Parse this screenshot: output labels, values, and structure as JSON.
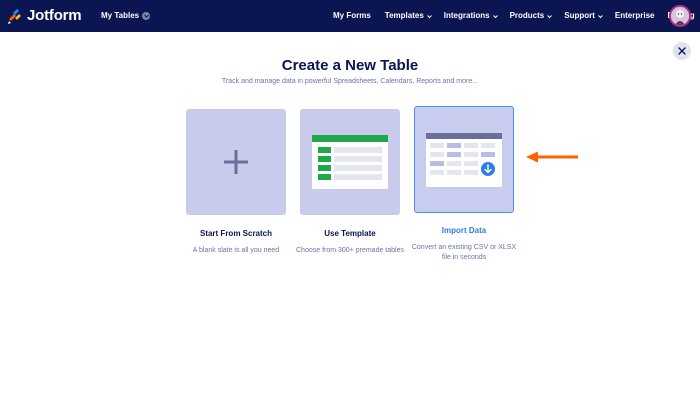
{
  "brand": {
    "name": "Jotform",
    "colors": {
      "navy": "#0a1551",
      "orange": "#ff6100",
      "blue": "#2e7de6",
      "card": "#c8cbec",
      "green": "#1fa84a",
      "yellow": "#ffb629"
    }
  },
  "topbar": {
    "my_tables_label": "My Tables",
    "nav_items": [
      {
        "label": "My Forms",
        "has_dropdown": false
      },
      {
        "label": "Templates",
        "has_dropdown": true
      },
      {
        "label": "Integrations",
        "has_dropdown": true
      },
      {
        "label": "Products",
        "has_dropdown": true
      },
      {
        "label": "Support",
        "has_dropdown": true
      },
      {
        "label": "Enterprise",
        "has_dropdown": false
      },
      {
        "label": "Pricing",
        "has_dropdown": false
      }
    ]
  },
  "dialog": {
    "title": "Create a New Table",
    "subtitle": "Track and manage data in powerful Spreadsheets, Calendars, Reports and more...",
    "close_icon": "close-icon"
  },
  "options": [
    {
      "title": "Start From Scratch",
      "description": "A blank slate is all you need",
      "icon": "plus-icon"
    },
    {
      "title": "Use Template",
      "description": "Choose from 300+ premade tables",
      "icon": "template-table-icon"
    },
    {
      "title": "Import Data",
      "description": "Convert an existing CSV or XLSX file in seconds",
      "icon": "import-table-icon",
      "selected": true
    }
  ]
}
